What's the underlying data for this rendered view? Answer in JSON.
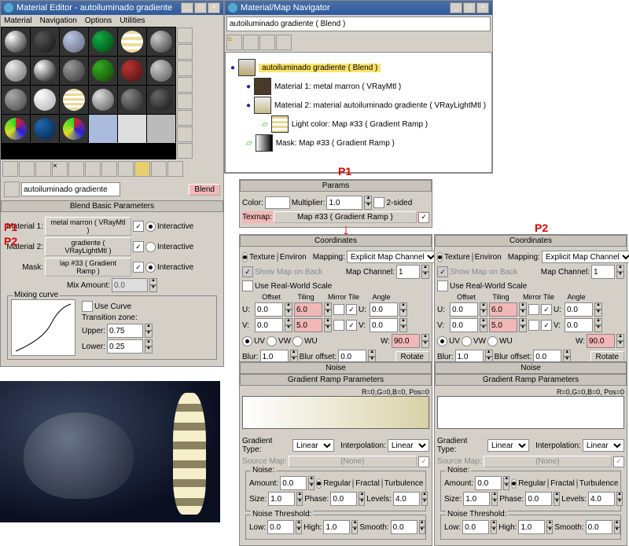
{
  "annotations": {
    "p1": "P1",
    "p2": "P2"
  },
  "editor": {
    "title": "Material Editor - autoiluminado gradiente",
    "menu": [
      "Material",
      "Navigation",
      "Options",
      "Utilities"
    ],
    "name_field": "autoiluminado gradiente",
    "type_btn": "Blend",
    "rollout1": {
      "title": "Blend Basic Parameters",
      "mat1_label": "Material 1:",
      "mat1_btn": "metal marron ( VRayMtl )",
      "mat1_interactive": "Interactive",
      "mat2_label": "Material 2:",
      "mat2_btn": "gradiente ( VRayLightMtl )",
      "mat2_interactive": "Interactive",
      "mask_label": "Mask:",
      "mask_btn": "lap #33 ( Gradient Ramp )",
      "mask_interactive": "Interactive",
      "mix_label": "Mix Amount:",
      "mix_val": "0.0",
      "mixing_curve": "Mixing curve",
      "use_curve": "Use Curve",
      "trans_zone": "Transition zone:",
      "upper_label": "Upper:",
      "upper_val": "0.75",
      "lower_label": "Lower:",
      "lower_val": "0.25"
    }
  },
  "navigator": {
    "title": "Material/Map Navigator",
    "current": "autoiluminado gradiente ( Blend )",
    "tree": [
      {
        "indent": 0,
        "label": "autoiluminado gradiente  ( Blend )",
        "hl": true
      },
      {
        "indent": 1,
        "label": "Material 1: metal marron  ( VRayMtl )"
      },
      {
        "indent": 1,
        "label": "Material 2: material autoiluminado gradiente  ( VRayLightMtl )"
      },
      {
        "indent": 2,
        "label": "Light color: Map #33  ( Gradient Ramp )"
      },
      {
        "indent": 1,
        "label": "Mask: Map #33  ( Gradient Ramp )"
      }
    ]
  },
  "params": {
    "title": "Params",
    "color": "Color:",
    "multiplier": "Multiplier:",
    "multiplier_val": "1.0",
    "twosided": "2-sided",
    "texmap": "Texmap:",
    "texmap_btn": "Map #33  ( Gradient Ramp )"
  },
  "coord": {
    "title": "Coordinates",
    "texture": "Texture",
    "environ": "Environ",
    "mapping": "Mapping:",
    "mapping_val": "Explicit Map Channel",
    "show_map": "Show Map on Back",
    "map_channel": "Map Channel:",
    "map_channel_val": "1",
    "use_rws": "Use Real-World Scale",
    "offset": "Offset",
    "tiling": "Tiling",
    "mirror_tile": "Mirror Tile",
    "angle": "Angle",
    "u": "U:",
    "u_off": "0.0",
    "u_til": "6.0",
    "u_ang": "0.0",
    "v": "V:",
    "v_off": "0.0",
    "v_til": "5.0",
    "v_ang": "0.0",
    "w": "W:",
    "w_ang": "90.0",
    "uv": "UV",
    "vw": "VW",
    "wu": "WU",
    "blur": "Blur:",
    "blur_val": "1.0",
    "blur_off": "Blur offset:",
    "blur_off_val": "0.0",
    "rotate": "Rotate"
  },
  "noise_hdr": "Noise",
  "ramp": {
    "title": "Gradient Ramp Parameters",
    "readout": "R=0,G=0,B=0, Pos=0",
    "grad_type": "Gradient Type:",
    "grad_type_val": "Linear",
    "interp": "Interpolation:",
    "interp_val": "Linear",
    "source_map": "Source Map:",
    "source_none": "(None)",
    "noise": "Noise:",
    "amount": "Amount:",
    "amount_val": "0.0",
    "regular": "Regular",
    "fractal": "Fractal",
    "turbulence": "Turbulence",
    "size": "Size:",
    "size_val": "1.0",
    "phase": "Phase:",
    "phase_val": "0.0",
    "levels": "Levels:",
    "levels_val": "4.0",
    "thresh": "Noise Threshold:",
    "low": "Low:",
    "low_val": "0.0",
    "high": "High:",
    "high_val": "1.0",
    "smooth": "Smooth:",
    "smooth_val": "0.0"
  }
}
